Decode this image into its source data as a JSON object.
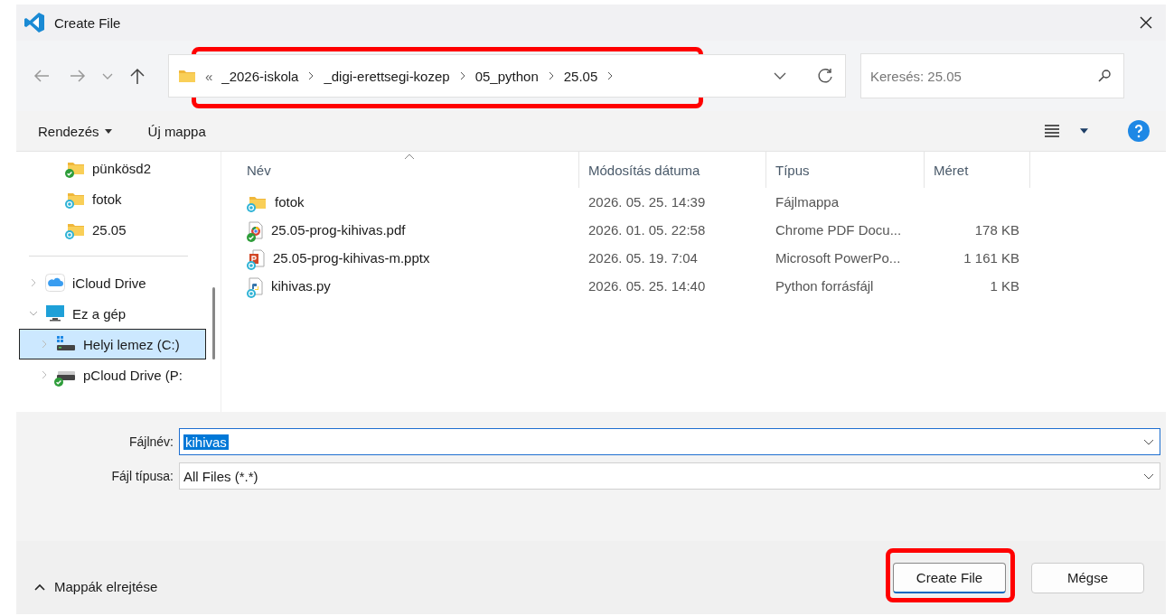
{
  "window": {
    "title": "Create File"
  },
  "address_bar": {
    "overflow": "«",
    "highlighted": true,
    "path": [
      "_2026-iskola",
      "_digi-erettsegi-kozep",
      "05_python",
      "25.05"
    ]
  },
  "search": {
    "placeholder": "Keresés: 25.05"
  },
  "toolbar": {
    "organize": "Rendezés",
    "new_folder": "Új mappa"
  },
  "sidebar": {
    "groups": [
      {
        "items": [
          {
            "label": "pünkösd2",
            "kind": "folder",
            "synced": true,
            "selected": false
          },
          {
            "label": "fotok",
            "kind": "folder",
            "synced": false,
            "selected": false
          },
          {
            "label": "25.05",
            "kind": "folder",
            "synced": false,
            "selected": false
          }
        ]
      },
      {
        "items": [
          {
            "label": "iCloud Drive",
            "kind": "cloud",
            "expanded": false,
            "selected": false
          },
          {
            "label": "Ez a gép",
            "kind": "pc",
            "expanded": true,
            "selected": false,
            "children": [
              {
                "label": "Helyi lemez (C:)",
                "kind": "disk",
                "expanded": false,
                "selected": true
              },
              {
                "label": "pCloud Drive (P:",
                "kind": "netdrive",
                "synced": true,
                "expanded": false,
                "selected": false
              }
            ]
          }
        ]
      }
    ]
  },
  "table": {
    "columns": [
      "Név",
      "Módosítás dátuma",
      "Típus",
      "Méret"
    ],
    "rows": [
      {
        "name": "fotok",
        "kind": "folder",
        "synced": false,
        "date": "2026. 05. 25. 14:39",
        "type": "Fájlmappa"
      },
      {
        "name": "25.05-prog-kihivas.pdf",
        "kind": "pdf",
        "synced": true,
        "date": "2026. 01. 05. 22:58",
        "type": "Chrome PDF Docu...",
        "size": "178 KB"
      },
      {
        "name": "25.05-prog-kihivas-m.pptx",
        "kind": "pptx",
        "synced": false,
        "date": "2026. 05. 19. 7:04",
        "type": "Microsoft PowerPo...",
        "size": "1 161 KB"
      },
      {
        "name": "kihivas.py",
        "kind": "python",
        "synced": false,
        "date": "2026. 05. 25. 14:40",
        "type": "Python forrásfájl",
        "size": "1 KB"
      }
    ]
  },
  "form": {
    "filename_label": "Fájlnév:",
    "filename": "kihivas",
    "filetype_label": "Fájl típusa:",
    "filetype": "All Files (*.*)"
  },
  "footer": {
    "toggle": "Mappák elrejtése"
  },
  "buttons": [
    {
      "label": "Create File",
      "primary": true,
      "highlighted": true
    },
    {
      "label": "Mégse",
      "primary": false,
      "highlighted": false
    }
  ]
}
